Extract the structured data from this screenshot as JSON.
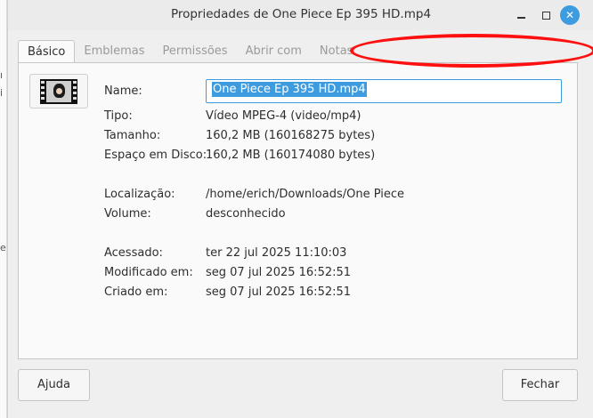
{
  "window": {
    "title": "Propriedades de One Piece Ep 395 HD.mp4"
  },
  "tabs": [
    {
      "label": "Básico",
      "active": true
    },
    {
      "label": "Emblemas",
      "active": false
    },
    {
      "label": "Permissões",
      "active": false
    },
    {
      "label": "Abrir com",
      "active": false
    },
    {
      "label": "Notas",
      "active": false
    }
  ],
  "basic": {
    "name_label": "Name:",
    "name_value": "One Piece Ep 395 HD.mp4",
    "rows": [
      {
        "label": "Tipo:",
        "value": "Vídeo MPEG-4 (video/mp4)"
      },
      {
        "label": "Tamanho:",
        "value": "160,2 MB (160168275 bytes)"
      },
      {
        "label": "Espaço em Disco:",
        "value": "160,2 MB (160174080 bytes)"
      },
      {
        "label": "Localização:",
        "value": "/home/erich/Downloads/One Piece"
      },
      {
        "label": "Volume:",
        "value": "desconhecido"
      },
      {
        "label": "Acessado:",
        "value": "ter 22 jul 2025 11:10:03"
      },
      {
        "label": "Modificado em:",
        "value": "seg 07 jul 2025 16:52:51"
      },
      {
        "label": "Criado em:",
        "value": "seg 07 jul 2025 16:52:51"
      }
    ]
  },
  "buttons": {
    "help": "Ajuda",
    "close": "Fechar"
  },
  "colors": {
    "accent": "#3d9be0",
    "annotation": "#ff1010"
  }
}
